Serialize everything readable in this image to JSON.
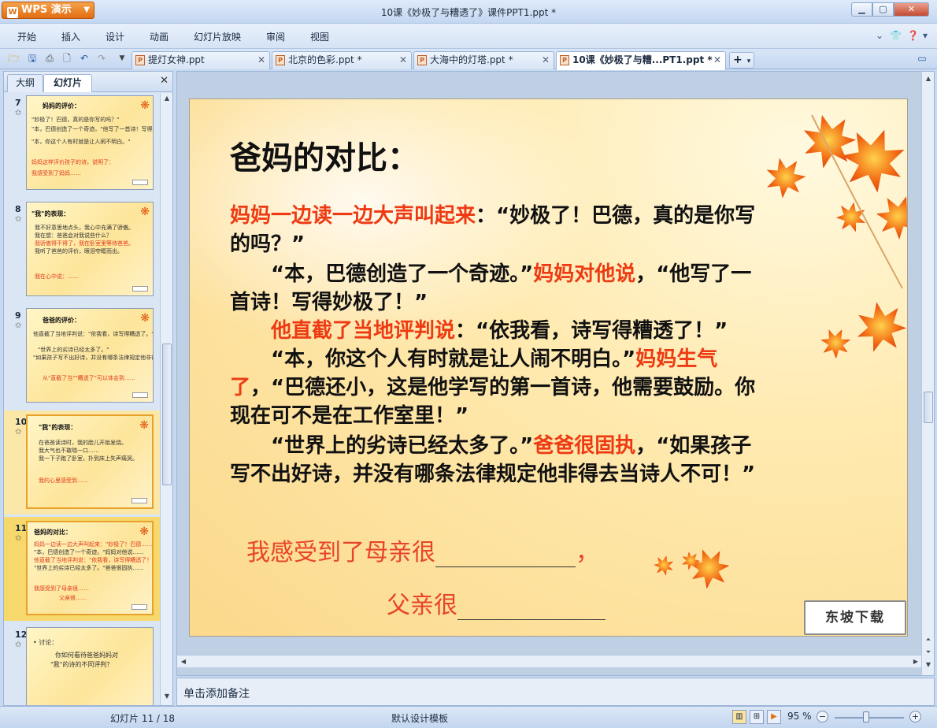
{
  "app": {
    "name": "WPS 演示",
    "window_title": "10课《妙极了与糟透了》课件PPT1.ppt *"
  },
  "menu": [
    "开始",
    "插入",
    "设计",
    "动画",
    "幻灯片放映",
    "审阅",
    "视图"
  ],
  "tabs": [
    {
      "label": "提灯女神.ppt"
    },
    {
      "label": "北京的色彩.ppt *"
    },
    {
      "label": "大海中的灯塔.ppt *"
    },
    {
      "label": "10课《妙极了与糟...PT1.ppt *"
    }
  ],
  "panel": {
    "outline_tab": "大纲",
    "slides_tab": "幻灯片"
  },
  "thumbnails": [
    {
      "num": "7",
      "lines": [
        {
          "text": "妈妈的评价：",
          "c": "t"
        },
        {
          "text": "\"妙极了！巴德，真的是你写的吗？\"",
          "c": ""
        },
        {
          "text": "\"本，巴德创造了一个奇迹。\"他写了一首诗！写得妙极了！\"",
          "c": ""
        },
        {
          "text": "\"本，你这个人有时就是让人闹不明白。\"",
          "c": ""
        },
        {
          "text": "妈妈这样评价孩子的诗，说明了：",
          "c": "r"
        },
        {
          "text": "我感受到了妈妈……",
          "c": "r"
        }
      ]
    },
    {
      "num": "8",
      "lines": [
        {
          "text": "\"我\"的表现：",
          "c": "t"
        },
        {
          "text": "我不好意思地点头，我心中充满了骄傲。",
          "c": ""
        },
        {
          "text": "我在想：爸爸会对我说些什么？",
          "c": ""
        },
        {
          "text": "我骄傲得不得了，我在卧室里等待爸爸。",
          "c": "r"
        },
        {
          "text": "我听了爸爸的评价，眼泪夺眶而出。",
          "c": ""
        },
        {
          "text": "我在心中说：……",
          "c": "r"
        }
      ]
    },
    {
      "num": "9",
      "lines": [
        {
          "text": "爸爸的评价：",
          "c": "t"
        },
        {
          "text": "他直截了当地评判说：\"依我看，诗写得糟透了。\"",
          "c": ""
        },
        {
          "text": "\"世界上的劣诗已经太多了。\"",
          "c": ""
        },
        {
          "text": "\"如果孩子写不出好诗，并没有哪条法律规定他非得去当诗人不可！\"",
          "c": ""
        },
        {
          "text": "从\"直截了当\"\"糟透了\"可以体会到……",
          "c": "r"
        }
      ]
    },
    {
      "num": "10",
      "lines": [
        {
          "text": "\"我\"的表现：",
          "c": "t"
        },
        {
          "text": "在爸爸读诗时，我的脸儿开始发烧。",
          "c": ""
        },
        {
          "text": "我大气也不敢喘一口……",
          "c": ""
        },
        {
          "text": "我一下子跑了卧室，扑到床上失声痛哭。",
          "c": ""
        },
        {
          "text": "我的心里感受到……",
          "c": "r"
        }
      ]
    },
    {
      "num": "11",
      "lines": [
        {
          "text": "爸妈的对比：",
          "c": "t"
        },
        {
          "text": "妈妈一边读一边大声叫起来：\"妙极了！巴德……\"",
          "c": "r"
        },
        {
          "text": "\"本，巴德创造了一个奇迹。\"妈妈对他说……",
          "c": ""
        },
        {
          "text": "他直截了当地评判说：\"依我看，诗写得糟透了！\"",
          "c": "r"
        },
        {
          "text": "\"世界上的劣诗已经太多了。\"爸爸很固执……",
          "c": ""
        },
        {
          "text": "我感受到了母亲很……",
          "c": "r"
        },
        {
          "text": "父亲很……",
          "c": "r"
        }
      ]
    },
    {
      "num": "12",
      "lines": [
        {
          "text": "• 讨论：",
          "c": ""
        },
        {
          "text": "你如何看待爸爸妈妈对",
          "c": ""
        },
        {
          "text": "\"我\"的诗的不同评判？",
          "c": ""
        }
      ]
    }
  ],
  "slide": {
    "title": "爸妈的对比：",
    "lines": [
      [
        {
          "t": "妈妈一边读一边大声叫起来",
          "r": true
        },
        {
          "t": "：“妙极了！巴德，真的是你写",
          "r": false
        }
      ],
      [
        {
          "t": "的吗？”",
          "r": false
        }
      ],
      [
        {
          "t": "　　“本，巴德创造了一个奇迹。”",
          "r": false
        },
        {
          "t": "妈妈对他说",
          "r": true
        },
        {
          "t": "，“他写了一",
          "r": false
        }
      ],
      [
        {
          "t": "首诗！写得妙极了！”",
          "r": false
        }
      ],
      [
        {
          "t": "　　",
          "r": false
        },
        {
          "t": "他直截了当地评判说",
          "r": true
        },
        {
          "t": "：“依我看，诗写得糟透了！”",
          "r": false
        }
      ],
      [
        {
          "t": "　　“本，你这个人有时就是让人闹不明白。”",
          "r": false
        },
        {
          "t": "妈妈生气",
          "r": true
        }
      ],
      [
        {
          "t": "了",
          "r": true
        },
        {
          "t": "，“巴德还小，这是他学写的第一首诗，他需要鼓励。你",
          "r": false
        }
      ],
      [
        {
          "t": "现在可不是在工作室里！”",
          "r": false
        }
      ],
      [
        {
          "t": "　　“世界上的劣诗已经太多了。”",
          "r": false
        },
        {
          "t": "爸爸很固执",
          "r": true
        },
        {
          "t": "，“如果孩子",
          "r": false
        }
      ],
      [
        {
          "t": "写不出好诗，并没有哪条法律规定他非得去当诗人不可！”",
          "r": false
        }
      ]
    ],
    "fill_mother": "我感受到了母亲很",
    "fill_mother_end": "，",
    "fill_father": "父亲很",
    "badge": "东坡下载"
  },
  "notes": {
    "placeholder": "单击添加备注"
  },
  "status": {
    "slide_count": "幻灯片 11 / 18",
    "template": "默认设计模板",
    "zoom": "95 %"
  },
  "colors": {
    "accent_red": "#ee3a12",
    "leaf_orange": "#e25a14"
  }
}
